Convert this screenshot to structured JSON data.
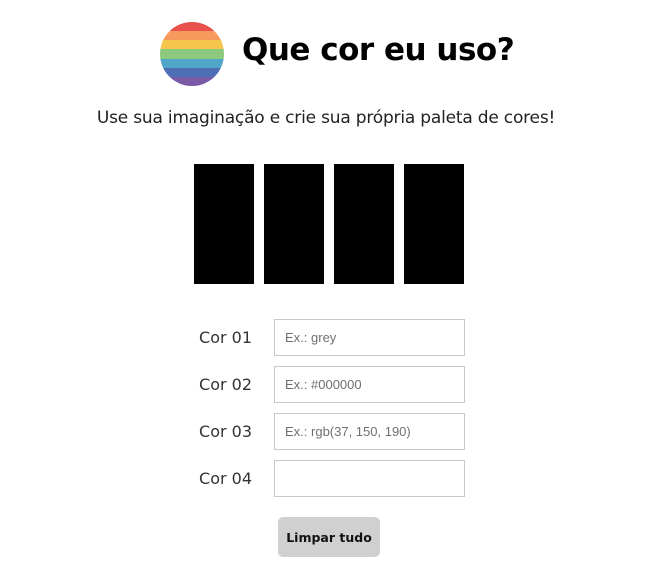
{
  "header": {
    "title": "Que cor eu uso?",
    "logo_icon": "rainbow-stripes-circle-icon",
    "logo_colors": [
      "#e8514d",
      "#f59a5c",
      "#f6c64c",
      "#8cc97e",
      "#4fa6c6",
      "#4c6fb6",
      "#7a5aa6"
    ]
  },
  "subtitle": "Use sua imaginação e crie sua própria paleta de cores!",
  "swatches": [
    {
      "color": "#000000"
    },
    {
      "color": "#000000"
    },
    {
      "color": "#000000"
    },
    {
      "color": "#000000"
    }
  ],
  "fields": [
    {
      "label": "Cor 01",
      "placeholder": "Ex.: grey",
      "value": ""
    },
    {
      "label": "Cor 02",
      "placeholder": "Ex.: #000000",
      "value": ""
    },
    {
      "label": "Cor 03",
      "placeholder": "Ex.: rgb(37, 150, 190)",
      "value": ""
    },
    {
      "label": "Cor 04",
      "placeholder": "",
      "value": ""
    }
  ],
  "clear_button": {
    "label": "Limpar tudo",
    "color": "#d0d0d0"
  }
}
